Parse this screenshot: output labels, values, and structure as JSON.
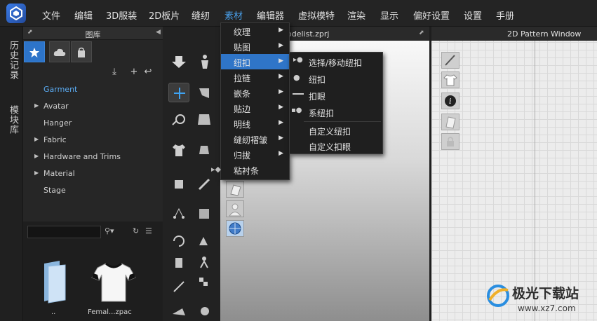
{
  "app": {
    "accent": "#2f75c8"
  },
  "menubar": {
    "items": [
      "文件",
      "编辑",
      "3D服装",
      "2D板片",
      "缝纫",
      "素材",
      "编辑器",
      "虚拟模特",
      "渲染",
      "显示",
      "偏好设置",
      "设置",
      "手册"
    ],
    "active": "素材"
  },
  "side_tabs": [
    "历史记录",
    "模块库"
  ],
  "library": {
    "title": "图库",
    "tabs": [
      "favorites-star-icon",
      "cloud-icon",
      "bag-icon"
    ],
    "toolbar": [
      "download-icon",
      "add-icon",
      "back-icon"
    ],
    "tree": [
      {
        "label": "Garment",
        "expandable": false,
        "selected": true
      },
      {
        "label": "Avatar",
        "expandable": true
      },
      {
        "label": "Hanger",
        "expandable": false
      },
      {
        "label": "Fabric",
        "expandable": true
      },
      {
        "label": "Hardware and Trims",
        "expandable": true
      },
      {
        "label": "Material",
        "expandable": true
      },
      {
        "label": "Stage",
        "expandable": false
      }
    ],
    "search_placeholder": "",
    "thumbnails": [
      {
        "label": "..",
        "icon": "folder-icon"
      },
      {
        "label": "Femal...zpac",
        "icon": "tshirt-icon"
      }
    ]
  },
  "viewport3d": {
    "title": "odelist.zprj"
  },
  "pattern2d": {
    "title": "2D Pattern Window"
  },
  "material_menu": {
    "items": [
      {
        "label": "纹理",
        "submenu": true
      },
      {
        "label": "贴图",
        "submenu": true
      },
      {
        "label": "纽扣",
        "submenu": true,
        "highlighted": true
      },
      {
        "label": "拉链",
        "submenu": true
      },
      {
        "label": "嵌条",
        "submenu": true
      },
      {
        "label": "贴边",
        "submenu": true
      },
      {
        "label": "明线",
        "submenu": true
      },
      {
        "label": "缝纫褶皱",
        "submenu": true
      },
      {
        "label": "归拔",
        "submenu": true
      },
      {
        "label": "粘衬条",
        "submenu": false
      }
    ]
  },
  "button_submenu": {
    "items": [
      {
        "label": "选择/移动纽扣"
      },
      {
        "label": "纽扣"
      },
      {
        "label": "扣眼"
      },
      {
        "label": "系纽扣"
      },
      {
        "label": "自定义纽扣"
      },
      {
        "label": "自定义扣眼"
      }
    ]
  },
  "watermark": {
    "name": "极光下载站",
    "url": "www.xz7.com"
  }
}
